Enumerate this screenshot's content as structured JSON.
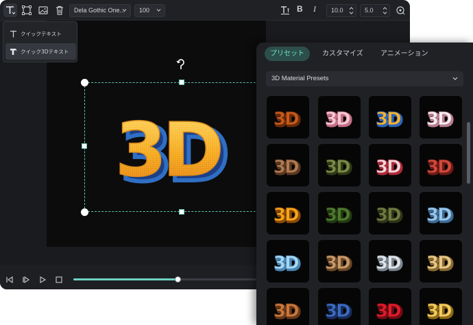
{
  "toolbar": {
    "font_family": "Dela Gothic One...",
    "font_size": "100",
    "bold_label": "B",
    "italic_label": "I",
    "letter_spacing": "10.0",
    "line_spacing": "5.0"
  },
  "text_menu": {
    "items": [
      {
        "label": "クイックテキスト"
      },
      {
        "label": "クイック3Dテキスト"
      }
    ]
  },
  "canvas": {
    "preview_text": "3D",
    "colors": {
      "bbox": "#64c3b0",
      "text_face": "#f6b62c",
      "text_side": "#2f6fc4"
    }
  },
  "playback": {
    "progress": 0.51
  },
  "panel": {
    "tabs": [
      {
        "label": "プリセット",
        "active": true
      },
      {
        "label": "カスタマイズ",
        "active": false
      },
      {
        "label": "アニメーション",
        "active": false
      }
    ],
    "preset_category": "3D Material Presets",
    "tile_label": "3D",
    "presets": [
      {
        "name": "copper-rust",
        "face": "#c65a1c",
        "edge": "#6a2a0a"
      },
      {
        "name": "pink-glass",
        "face": "#f7c8d4",
        "edge": "#c46f88"
      },
      {
        "name": "gold-blue",
        "face": "#f4b22a",
        "edge": "#2d64b8"
      },
      {
        "name": "pearl-white",
        "face": "#f3eef0",
        "edge": "#b87d92"
      },
      {
        "name": "bronze-matte",
        "face": "#b07a52",
        "edge": "#5a3820"
      },
      {
        "name": "camo-green",
        "face": "#7c8a46",
        "edge": "#2e3a18"
      },
      {
        "name": "marble-red",
        "face": "#f0d8dc",
        "edge": "#b02a3a"
      },
      {
        "name": "red-marble",
        "face": "#d24a3c",
        "edge": "#6e1c18"
      },
      {
        "name": "amber-gold",
        "face": "#f5a51a",
        "edge": "#8a4a06"
      },
      {
        "name": "moss-green",
        "face": "#4f7a2e",
        "edge": "#223a12"
      },
      {
        "name": "olive-stone",
        "face": "#6e7a40",
        "edge": "#2e3418"
      },
      {
        "name": "ice-blue",
        "face": "#9cc8e8",
        "edge": "#3e6c96"
      },
      {
        "name": "crystal-blue",
        "face": "#a8d8f2",
        "edge": "#4a86b4"
      },
      {
        "name": "sand-bronze",
        "face": "#c79a6c",
        "edge": "#6c4826"
      },
      {
        "name": "silver-chrome",
        "face": "#dfe4e8",
        "edge": "#7a8590"
      },
      {
        "name": "champagne-gold",
        "face": "#e6c88a",
        "edge": "#8a6a30"
      },
      {
        "name": "terracotta",
        "face": "#c8783e",
        "edge": "#6a3818"
      },
      {
        "name": "navy-metal",
        "face": "#3a6cc0",
        "edge": "#1a2c5a"
      },
      {
        "name": "ruby-red",
        "face": "#e01c2c",
        "edge": "#700c14"
      },
      {
        "name": "gold-foil",
        "face": "#f2cc64",
        "edge": "#8e6a16"
      }
    ]
  }
}
